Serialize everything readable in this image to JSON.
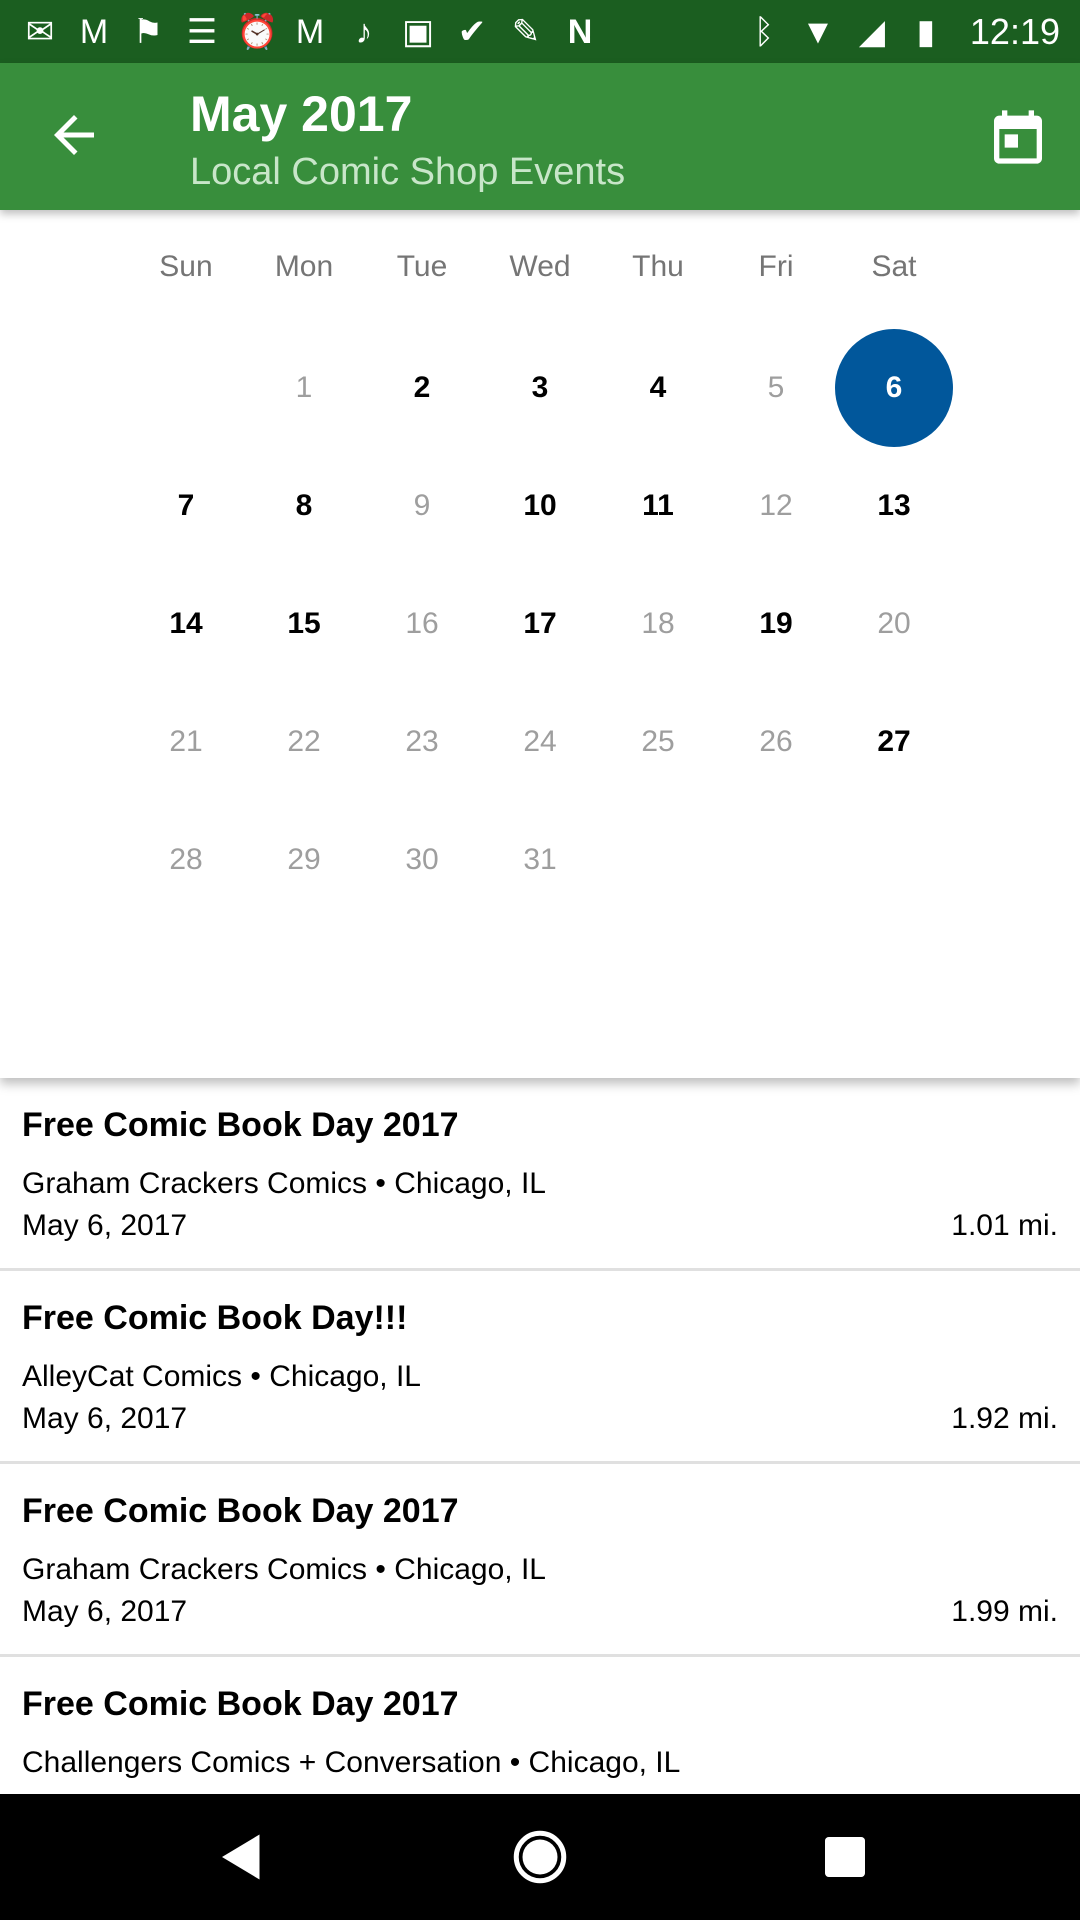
{
  "status_bar": {
    "time": "12:19",
    "icons": [
      "messages-icon",
      "gmail-icon",
      "flag-icon",
      "news-icon",
      "alarm-icon",
      "gmail-icon",
      "music-icon",
      "photo-icon",
      "check-icon",
      "edit-icon",
      "n-icon",
      "bluetooth-icon",
      "wifi-icon",
      "signal-icon",
      "battery-charging-icon"
    ]
  },
  "toolbar": {
    "title": "May 2017",
    "subtitle": "Local Comic Shop Events",
    "color": "#388e3c"
  },
  "calendar": {
    "weekdays": [
      "Sun",
      "Mon",
      "Tue",
      "Wed",
      "Thu",
      "Fri",
      "Sat"
    ],
    "weeks": [
      [
        {
          "d": ""
        },
        {
          "d": "1"
        },
        {
          "d": "2",
          "ev": true
        },
        {
          "d": "3",
          "ev": true
        },
        {
          "d": "4",
          "ev": true
        },
        {
          "d": "5"
        },
        {
          "d": "6",
          "sel": true
        }
      ],
      [
        {
          "d": "7",
          "ev": true
        },
        {
          "d": "8",
          "ev": true
        },
        {
          "d": "9"
        },
        {
          "d": "10",
          "ev": true
        },
        {
          "d": "11",
          "ev": true
        },
        {
          "d": "12"
        },
        {
          "d": "13",
          "ev": true
        }
      ],
      [
        {
          "d": "14",
          "ev": true
        },
        {
          "d": "15",
          "ev": true
        },
        {
          "d": "16"
        },
        {
          "d": "17",
          "ev": true
        },
        {
          "d": "18"
        },
        {
          "d": "19",
          "ev": true
        },
        {
          "d": "20"
        }
      ],
      [
        {
          "d": "21"
        },
        {
          "d": "22"
        },
        {
          "d": "23"
        },
        {
          "d": "24"
        },
        {
          "d": "25"
        },
        {
          "d": "26"
        },
        {
          "d": "27",
          "ev": true
        }
      ],
      [
        {
          "d": "28"
        },
        {
          "d": "29"
        },
        {
          "d": "30"
        },
        {
          "d": "31"
        },
        {
          "d": ""
        },
        {
          "d": ""
        },
        {
          "d": ""
        }
      ]
    ],
    "selected_color": "#01579b"
  },
  "events": [
    {
      "title": "Free Comic Book Day 2017",
      "venue": "Graham Crackers Comics • Chicago, IL",
      "date": "May 6, 2017",
      "distance": "1.01 mi."
    },
    {
      "title": "Free Comic Book Day!!!",
      "venue": "AlleyCat Comics • Chicago, IL",
      "date": "May 6, 2017",
      "distance": "1.92 mi."
    },
    {
      "title": "Free Comic Book Day 2017",
      "venue": "Graham Crackers Comics • Chicago, IL",
      "date": "May 6, 2017",
      "distance": "1.99 mi."
    },
    {
      "title": "Free Comic Book Day 2017",
      "venue": "Challengers Comics + Conversation • Chicago, IL",
      "date": "",
      "distance": ""
    }
  ]
}
